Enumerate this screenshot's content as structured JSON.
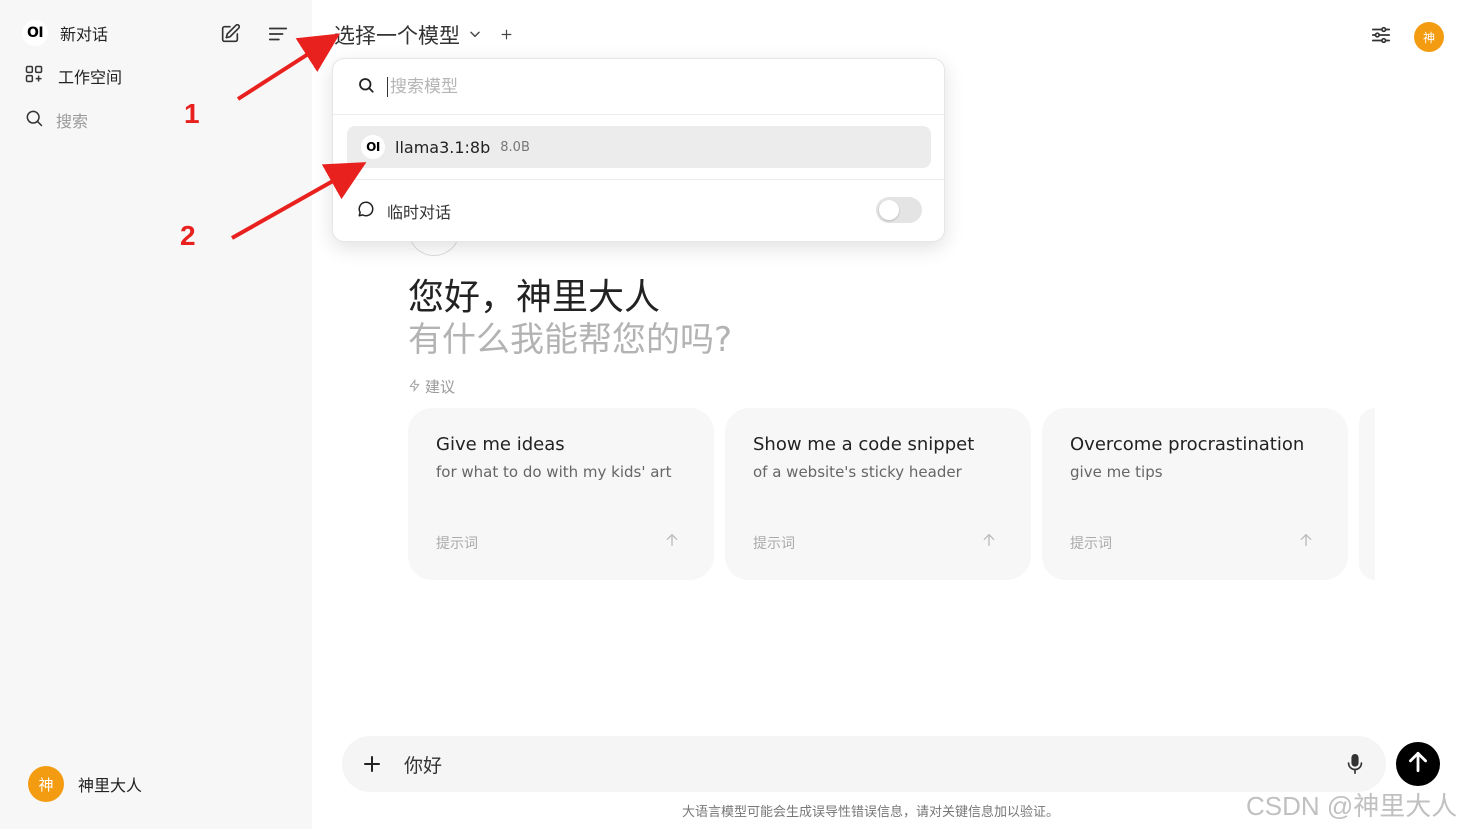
{
  "sidebar": {
    "logo_text": "OI",
    "new_chat": "新对话",
    "workspace": "工作空间",
    "search": "搜索",
    "user_avatar": "神",
    "user_name": "神里大人"
  },
  "header": {
    "model_select_label": "选择一个模型",
    "user_avatar": "神"
  },
  "dropdown": {
    "search_placeholder": "搜索模型",
    "model_logo": "OI",
    "model_name": "llama3.1:8b",
    "model_size": "8.0B",
    "temp_chat_label": "临时对话"
  },
  "greeting": {
    "title": "您好，神里大人",
    "subtitle": "有什么我能帮您的吗?"
  },
  "suggestions": {
    "label": "建议",
    "cards": [
      {
        "title": "Give me ideas",
        "subtitle": "for what to do with my kids' art",
        "prompt": "提示词"
      },
      {
        "title": "Show me a code snippet",
        "subtitle": "of a website's sticky header",
        "prompt": "提示词"
      },
      {
        "title": "Overcome procrastination",
        "subtitle": "give me tips",
        "prompt": "提示词"
      }
    ]
  },
  "input": {
    "value": "你好"
  },
  "disclaimer": "大语言模型可能会生成误导性错误信息，请对关键信息加以验证。",
  "watermark": "CSDN @神里大人",
  "annotations": {
    "label1": "1",
    "label2": "2",
    "color": "#e8211e"
  }
}
